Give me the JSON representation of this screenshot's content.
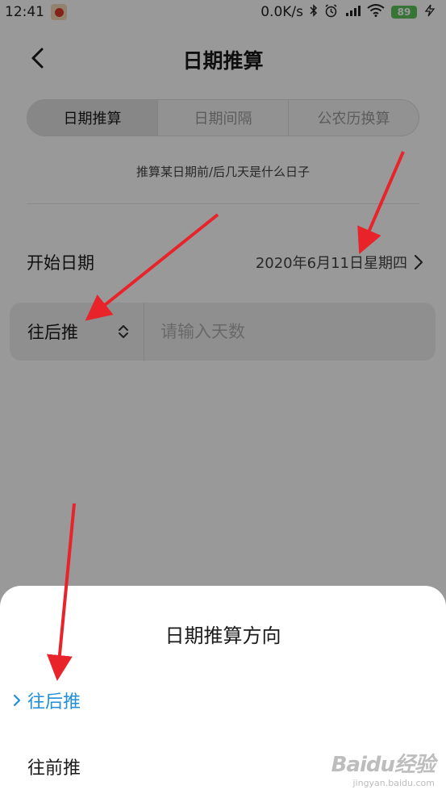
{
  "status_bar": {
    "time": "12:41",
    "network_speed": "0.0K/s",
    "battery": "89",
    "icons": [
      "bluetooth-icon",
      "alarm-icon",
      "signal-icon",
      "wifi-icon",
      "battery-icon",
      "charging-icon"
    ]
  },
  "header": {
    "title": "日期推算",
    "back_icon": "chevron-left-icon"
  },
  "tabs": [
    {
      "label": "日期推算",
      "active": true
    },
    {
      "label": "日期间隔",
      "active": false
    },
    {
      "label": "公农历换算",
      "active": false
    }
  ],
  "hint": "推算某日期前/后几天是什么日子",
  "start_date": {
    "label": "开始日期",
    "value": "2020年6月11日星期四"
  },
  "direction": {
    "value": "往后推"
  },
  "days_input": {
    "placeholder": "请输入天数",
    "value": ""
  },
  "sheet": {
    "title": "日期推算方向",
    "options": [
      {
        "label": "往后推",
        "selected": true
      },
      {
        "label": "往前推",
        "selected": false
      }
    ]
  },
  "watermark": {
    "text": "Baidu经验",
    "url": "jingyan.baidu.com"
  },
  "colors": {
    "accent": "#1f8fdc",
    "annotation_arrow": "#e8232a",
    "overlay": "rgba(0,0,0,0.40)",
    "battery": "#5cc35c"
  }
}
